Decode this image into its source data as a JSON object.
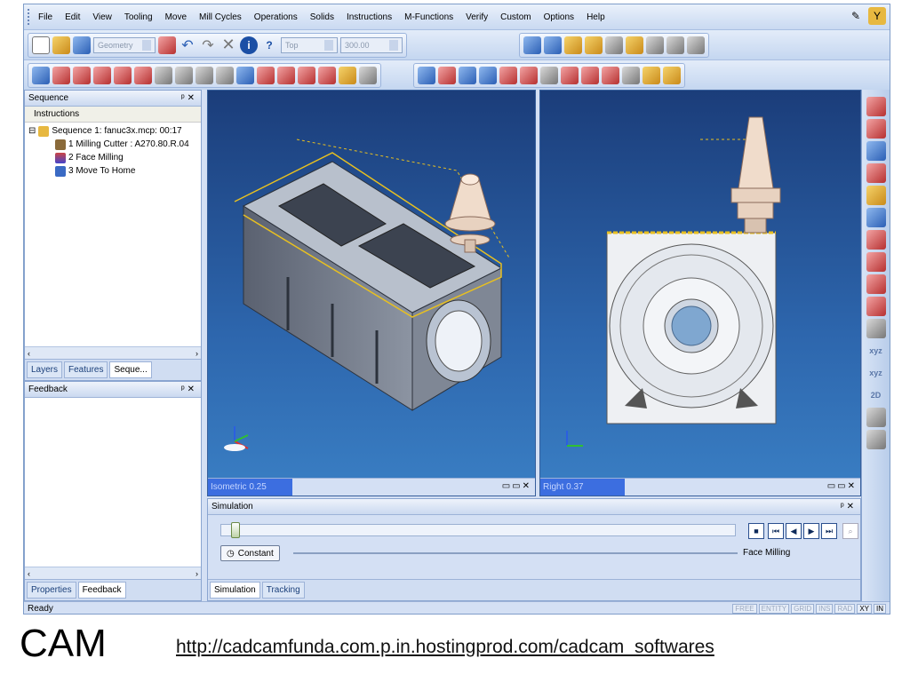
{
  "menu": {
    "items": [
      "File",
      "Edit",
      "View",
      "Tooling",
      "Move",
      "Mill Cycles",
      "Operations",
      "Solids",
      "Instructions",
      "M-Functions",
      "Verify",
      "Custom",
      "Options",
      "Help"
    ]
  },
  "toolbar": {
    "geometry_combo": "Geometry",
    "view_combo": "Top",
    "value_combo": "300.00"
  },
  "sequence_panel": {
    "title": "Sequence",
    "header": "Instructions",
    "tree": [
      {
        "label": "Sequence 1: fanuc3x.mcp: 00:17",
        "expander": "⊟"
      },
      {
        "label": "1 Milling Cutter : A270.80.R.04"
      },
      {
        "label": "2 Face Milling"
      },
      {
        "label": "3 Move To Home"
      }
    ],
    "tabs": [
      "Layers",
      "Features",
      "Seque..."
    ]
  },
  "feedback_panel": {
    "title": "Feedback",
    "tabs": [
      "Properties",
      "Feedback"
    ]
  },
  "viewports": {
    "left_label": "Isometric 0.25",
    "right_label": "Right 0.37"
  },
  "simulation": {
    "title": "Simulation",
    "progress_fraction": 0.02,
    "speed_label": "Constant",
    "operation_label": "Face Milling",
    "tabs": [
      "Simulation",
      "Tracking"
    ],
    "controls": [
      "■",
      "⏮",
      "◀",
      "▶",
      "⏭"
    ]
  },
  "right_toolbar": {
    "text_items": [
      "xyz",
      "xyz",
      "2D"
    ]
  },
  "status": {
    "text": "Ready",
    "flags": [
      "FREE",
      "ENTITY",
      "GRID",
      "INS",
      "RAD",
      "XY",
      "IN"
    ]
  },
  "caption": {
    "title": "CAM",
    "link": "http://cadcamfunda.com.p.in.hostingprod.com/cadcam_softwares"
  },
  "colors": {
    "app_bg": "#d4e0f4",
    "viewport_top": "#1b3d7a",
    "viewport_bottom": "#3a7fc4",
    "label_bg": "#3c6ee0",
    "toolpath": "#e8c020"
  }
}
